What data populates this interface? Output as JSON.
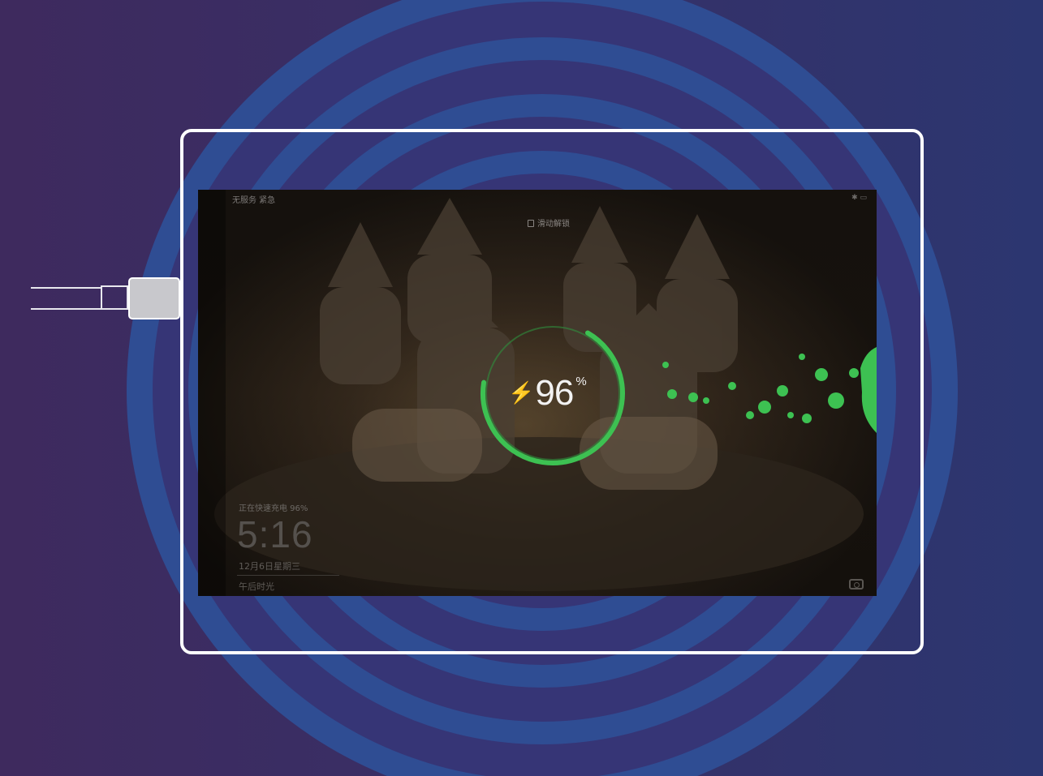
{
  "lockscreen": {
    "carrier": "无服务 紧急",
    "status_icons": "✱ ▭",
    "unlock_hint": "滑动解锁",
    "battery_level": 96,
    "battery_percent_number": "96",
    "battery_unit": "%",
    "charging_status": "正在快速充电 96%",
    "time": "5:16",
    "date": "12月6日星期三",
    "greeting": "午后时光"
  },
  "colors": {
    "background_left": "#3e2a5e",
    "background_right": "#2c3670",
    "ring_blue": "#2b74b6",
    "charge_green": "#3dc152",
    "frame": "#ffffff"
  },
  "icons": [
    "cable-icon",
    "plug-icon",
    "lightning-bolt-icon",
    "lock-icon",
    "camera-icon"
  ]
}
